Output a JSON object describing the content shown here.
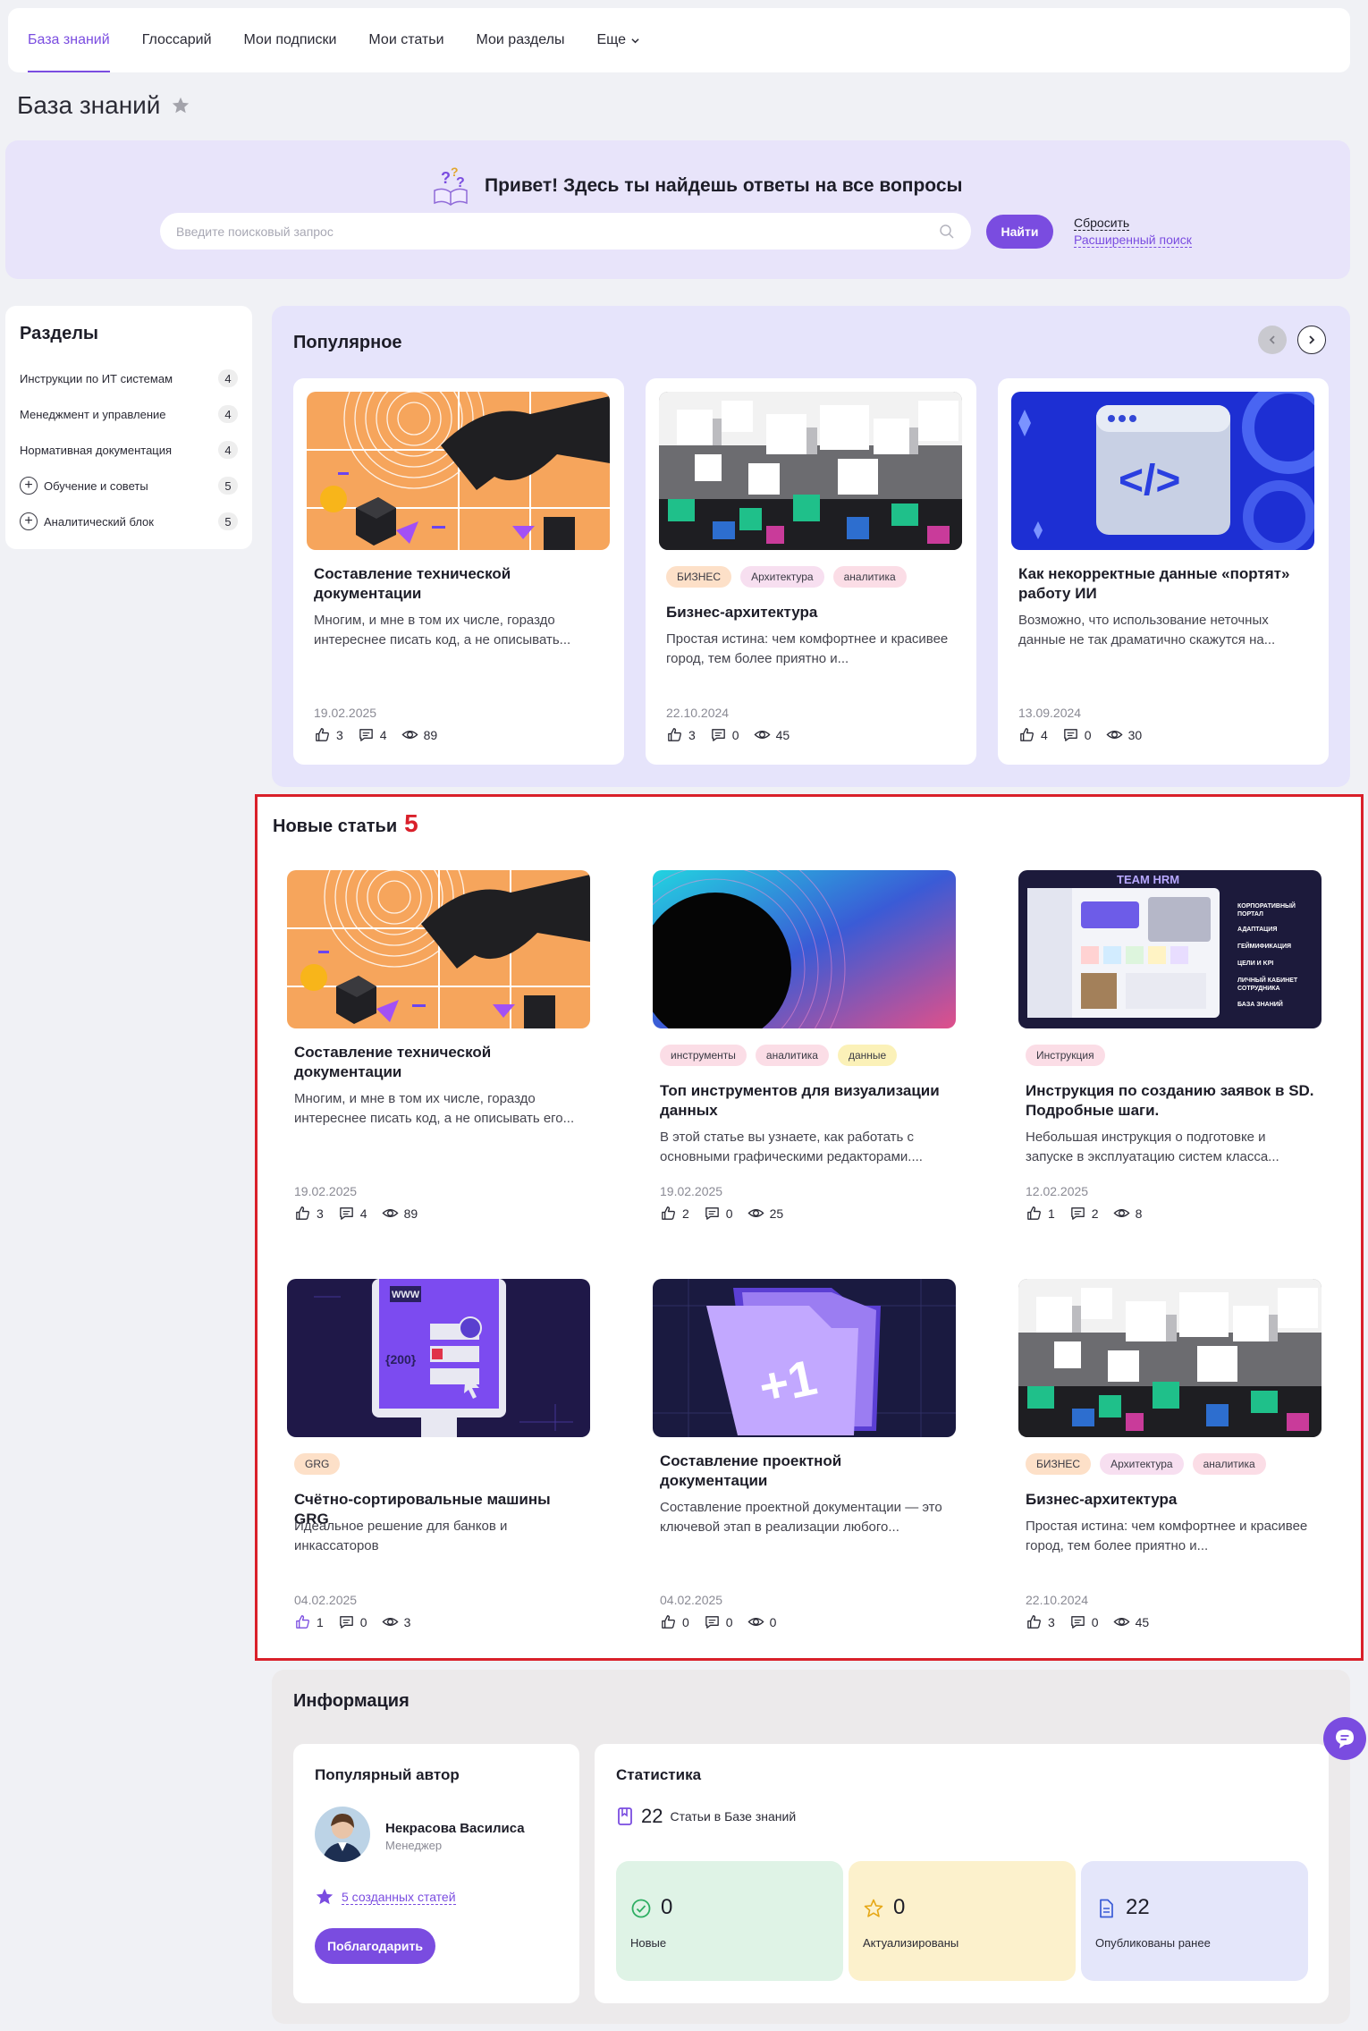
{
  "nav": {
    "tabs": [
      {
        "label": "База знаний"
      },
      {
        "label": "Глоссарий"
      },
      {
        "label": "Мои подписки"
      },
      {
        "label": "Мои статьи"
      },
      {
        "label": "Мои разделы"
      },
      {
        "label": "Еще"
      }
    ]
  },
  "page": {
    "title": "База знаний"
  },
  "hero": {
    "title": "Привет! Здесь ты найдешь ответы на все вопросы",
    "search_placeholder": "Введите поисковый запрос",
    "search_value": "",
    "find_label": "Найти",
    "reset_label": "Сбросить",
    "advanced_label": "Расширенный поиск"
  },
  "sidebar": {
    "title": "Разделы",
    "items": [
      {
        "label": "Инструкции по ИТ системам",
        "count": "4"
      },
      {
        "label": "Менеджмент и управление",
        "count": "4"
      },
      {
        "label": "Нормативная документация",
        "count": "4"
      },
      {
        "label": "Обучение и советы",
        "count": "5"
      },
      {
        "label": "Аналитический блок",
        "count": "5"
      }
    ]
  },
  "popular": {
    "title": "Популярное",
    "cards": [
      {
        "title": "Составление технической документации",
        "excerpt": "Многим, и мне в том их числе, гораздо интереснее писать код, а не описывать...",
        "date": "19.02.2025",
        "likes": "3",
        "comments": "4",
        "views": "89",
        "tags": []
      },
      {
        "title": "Бизнес-архитектура",
        "excerpt": "Простая истина: чем комфортнее и красивее город, тем более приятно и...",
        "date": "22.10.2024",
        "likes": "3",
        "comments": "0",
        "views": "45",
        "tags": [
          "БИЗНЕС",
          "Архитектура",
          "аналитика"
        ]
      },
      {
        "title": "Как некорректные данные «портят» работу ИИ",
        "excerpt": "Возможно, что использование неточных данные не так драматично скажутся на...",
        "date": "13.09.2024",
        "likes": "4",
        "comments": "0",
        "views": "30",
        "tags": []
      }
    ]
  },
  "new_articles": {
    "title": "Новые статьи",
    "count": "5",
    "cards": [
      {
        "title": "Составление технической документации",
        "excerpt": "Многим, и мне в том их числе, гораздо интереснее писать код, а не описывать его...",
        "date": "19.02.2025",
        "likes": "3",
        "comments": "4",
        "views": "89",
        "tags": []
      },
      {
        "title": "Топ инструментов для визуализации данных",
        "excerpt": "В этой статье вы узнаете, как работать с основными графическими редакторами....",
        "date": "19.02.2025",
        "likes": "2",
        "comments": "0",
        "views": "25",
        "tags": [
          "инструменты",
          "аналитика",
          "данные"
        ]
      },
      {
        "title": "Инструкция по созданию заявок в SD. Подробные шаги.",
        "excerpt": "Небольшая инструкция о подготовке и запуске в эксплуатацию систем класса...",
        "date": "12.02.2025",
        "likes": "1",
        "comments": "2",
        "views": "8",
        "tags": [
          "Инструкция"
        ],
        "thumb_text": [
          "TEAM HRM",
          "КОРПОРАТИВНЫЙ ПОРТАЛ",
          "АДАПТАЦИЯ",
          "ГЕЙМИФИКАЦИЯ",
          "ЦЕЛИ И KPI",
          "ЛИЧНЫЙ КАБИНЕТ СОТРУДНИКА",
          "БАЗА ЗНАНИЙ"
        ]
      },
      {
        "title": "Счётно-сортировальные машины GRG",
        "excerpt": "Идеальное решение для банков и инкассаторов",
        "date": "04.02.2025",
        "likes": "1",
        "comments": "0",
        "views": "3",
        "tags": [
          "GRG"
        ],
        "thumb_text": [
          "WWW",
          "{200}"
        ]
      },
      {
        "title": "Составление проектной документации",
        "excerpt": "Составление проектной документации — это ключевой этап в реализации любого...",
        "date": "04.02.2025",
        "likes": "0",
        "comments": "0",
        "views": "0",
        "tags": [],
        "thumb_text": [
          "+1"
        ]
      },
      {
        "title": "Бизнес-архитектура",
        "excerpt": "Простая истина: чем комфортнее и красивее город, тем более приятно и...",
        "date": "22.10.2024",
        "likes": "3",
        "comments": "0",
        "views": "45",
        "tags": [
          "БИЗНЕС",
          "Архитектура",
          "аналитика"
        ]
      }
    ]
  },
  "info": {
    "title": "Информация",
    "author": {
      "heading": "Популярный автор",
      "name": "Некрасова Василиса",
      "role": "Менеджер",
      "articles_link": "5 созданных статей",
      "thank_label": "Поблагодарить"
    },
    "stats": {
      "heading": "Статистика",
      "total": "22",
      "total_label": "Статьи в Базе знаний",
      "tiles": [
        {
          "value": "0",
          "label": "Новые",
          "color": "#dff3e6"
        },
        {
          "value": "0",
          "label": "Актуализированы",
          "color": "#fcf1cc"
        },
        {
          "value": "22",
          "label": "Опубликованы ранее",
          "color": "#e4e6fa"
        }
      ]
    }
  },
  "colors": {
    "accent": "#7a4ce0",
    "highlight_border": "#d9202a"
  }
}
